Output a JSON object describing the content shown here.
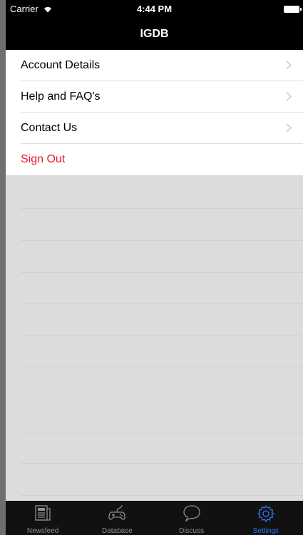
{
  "status_bar": {
    "carrier": "Carrier",
    "time": "4:44 PM"
  },
  "nav": {
    "title": "IGDB"
  },
  "menu": {
    "items": [
      {
        "label": "Account Details"
      },
      {
        "label": "Help and FAQ's"
      },
      {
        "label": "Contact Us"
      },
      {
        "label": "Sign Out"
      }
    ]
  },
  "tabs": [
    {
      "label": "Newsfeed",
      "icon": "newspaper-icon"
    },
    {
      "label": "Database",
      "icon": "gamepad-icon"
    },
    {
      "label": "Discuss",
      "icon": "chat-bubble-icon"
    },
    {
      "label": "Settings",
      "icon": "gear-icon"
    }
  ],
  "colors": {
    "accent": "#2f7cf6",
    "danger": "#e8192c",
    "bar_background": "#000000",
    "table_background": "#dcdcdc"
  }
}
